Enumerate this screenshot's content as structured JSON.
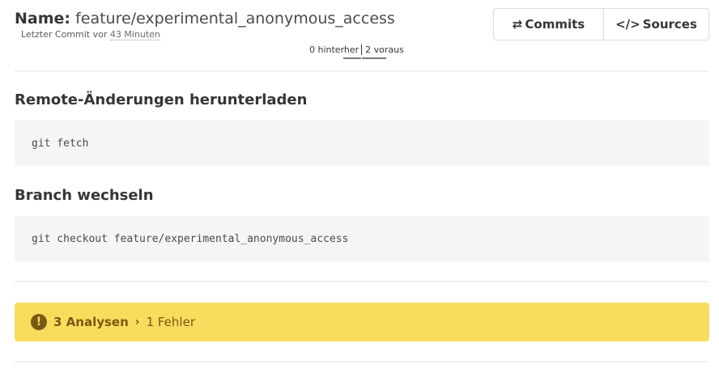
{
  "header": {
    "name_label": "Name:",
    "branch_name": "feature/experimental_anonymous_access",
    "last_commit_prefix": "Letzter Commit vor",
    "last_commit_relative": "43 Minuten",
    "behind_text": "0 hinterher",
    "ahead_text": "2 voraus"
  },
  "toolbar": {
    "commits_icon": "⇄",
    "commits_label": "Commits",
    "sources_icon": "</>",
    "sources_label": "Sources"
  },
  "sections": [
    {
      "title": "Remote-Änderungen herunterladen",
      "command": "git fetch"
    },
    {
      "title": "Branch wechseln",
      "command": "git checkout feature/experimental_anonymous_access"
    }
  ],
  "notification": {
    "icon": "!",
    "analyses_label": "3 Analysen",
    "separator": "›",
    "errors_label": "1 Fehler",
    "background_color": "#f8dc5e"
  }
}
